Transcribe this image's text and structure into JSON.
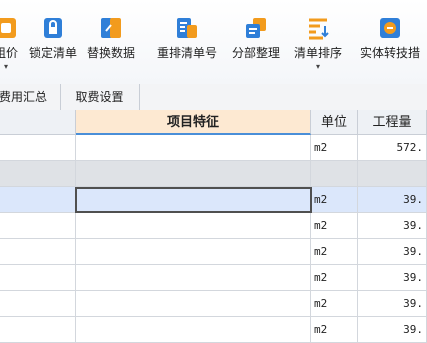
{
  "toolbar": {
    "buttons": [
      {
        "label": "组价"
      },
      {
        "label": "锁定清单"
      },
      {
        "label": "替换数据"
      },
      {
        "label": "重排清单号"
      },
      {
        "label": "分部整理"
      },
      {
        "label": "清单排序"
      },
      {
        "label": "实体转技措"
      }
    ],
    "caret_glyph": "▾"
  },
  "tabs": [
    {
      "label": "费用汇总"
    },
    {
      "label": "取费设置"
    }
  ],
  "columns": [
    {
      "label": ""
    },
    {
      "label": "项目特征"
    },
    {
      "label": "单位"
    },
    {
      "label": "工程量"
    }
  ],
  "rows": [
    {
      "unit": "m2",
      "qty": "572.",
      "type": "normal"
    },
    {
      "unit": "",
      "qty": "",
      "type": "group"
    },
    {
      "unit": "m2",
      "qty": "39.",
      "type": "selected"
    },
    {
      "unit": "m2",
      "qty": "39.",
      "type": "normal"
    },
    {
      "unit": "m2",
      "qty": "39.",
      "type": "normal"
    },
    {
      "unit": "m2",
      "qty": "39.",
      "type": "normal"
    },
    {
      "unit": "m2",
      "qty": "39.",
      "type": "normal"
    },
    {
      "unit": "m2",
      "qty": "39.",
      "type": "normal"
    }
  ],
  "colors": {
    "accent": "#2f7fd8",
    "orange": "#f29b1d",
    "header_active": "#fde9d2",
    "selected_row": "#dbe7fb"
  }
}
